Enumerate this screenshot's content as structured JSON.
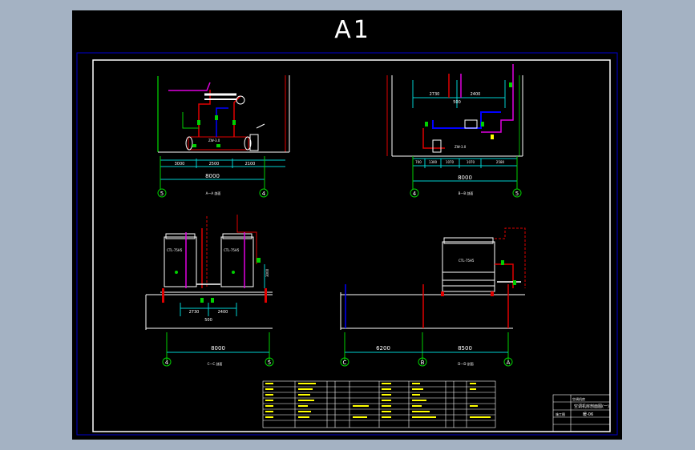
{
  "sheet": {
    "size_label": "A1",
    "colors": {
      "background": "#a4b2c3",
      "paper": "#000000",
      "frame_outer": "#0000d0",
      "frame_inner": "#ffffff",
      "dim": "#00d0d0",
      "wall": "#00b000",
      "pipe_red": "#e00000",
      "pipe_blue": "#0000ff",
      "pipe_magenta": "#e000e0",
      "pipe_green": "#00d000",
      "axis": "#00c000",
      "text": "#ffffff",
      "yellow": "#ffff00"
    }
  },
  "views": {
    "top_left": {
      "dims": [
        "3000",
        "2500",
        "2100"
      ],
      "total": "8000",
      "axis_left": "5",
      "axis_right": "4",
      "caption": "A—A 剖面",
      "equipment": "ZW-3.0"
    },
    "top_right": {
      "dims_upper": [
        "2730",
        "2400"
      ],
      "dim_center": "500",
      "dims": [
        "700",
        "1300",
        "1070",
        "1070",
        "2580"
      ],
      "total": "8000",
      "axis_left": "4",
      "axis_right": "5",
      "caption": "B—B 剖面",
      "equipment": "ZW-3.0"
    },
    "bottom_left": {
      "dims": [
        "2730",
        "2400"
      ],
      "dim_center": "500",
      "height": "3000",
      "total": "8000",
      "axis_left": "4",
      "axis_right": "5",
      "caption": "C—C 剖面",
      "unit_label": "CTL-75H5"
    },
    "bottom_right": {
      "dims": [
        "6200",
        "8500"
      ],
      "axis_left": "C",
      "axis_mid": "B",
      "axis_right": "A",
      "caption": "D—D 剖面",
      "unit_label": "CTL-75H5"
    }
  },
  "title_block": {
    "project": "空调机房",
    "drawing_name": "空调机房剖面图(一)",
    "drawing_no": "暖-06",
    "stage": "施工图"
  }
}
